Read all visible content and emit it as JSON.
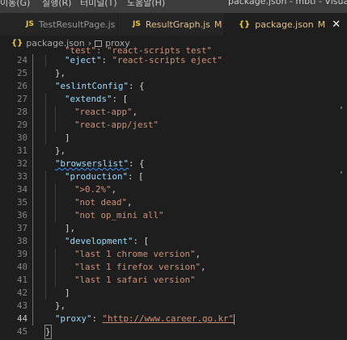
{
  "menubar": {
    "items": [
      "이동(G)",
      "실행(R)",
      "터미널(T)",
      "도움말(H)"
    ],
    "title": "package.json - mbti - Visual Studi"
  },
  "tabs": [
    {
      "label": "TestResultPage.js",
      "icon": "JS",
      "modified": ""
    },
    {
      "label": "ResultGraph.js",
      "icon": "JS",
      "modified": "M"
    },
    {
      "label": "package.json",
      "icon": "{}",
      "modified": "M",
      "close": "✕"
    }
  ],
  "breadcrumb": {
    "icon": "{}",
    "file": "package.json",
    "separator": "›",
    "property": "proxy"
  },
  "editor": {
    "line_numbers": [
      "24",
      "25",
      "26",
      "27",
      "28",
      "29",
      "30",
      "31",
      "32",
      "33",
      "34",
      "35",
      "36",
      "37",
      "38",
      "39",
      "40",
      "41",
      "42",
      "43",
      "44",
      "45"
    ],
    "partial_line": "\"eject\": \"react-scripts eject\"",
    "lines": [
      {
        "key": "\"eject\"",
        "colon": ": ",
        "value": "\"react-scripts eject\"",
        "end": ""
      },
      {
        "text": "},"
      },
      {
        "key": "\"eslintConfig\"",
        "colon": ": ",
        "text_end": "{"
      },
      {
        "key": "\"extends\"",
        "colon": ": ",
        "text_end": "["
      },
      {
        "value": "\"react-app\"",
        "end": ","
      },
      {
        "value": "\"react-app/jest\"",
        "end": ""
      },
      {
        "text": "]"
      },
      {
        "text": "},"
      },
      {
        "key": "\"browserslist\"",
        "colon": ": ",
        "text_end": "{"
      },
      {
        "key": "\"production\"",
        "colon": ": ",
        "text_end": "["
      },
      {
        "value": "\">0.2%\"",
        "end": ","
      },
      {
        "value": "\"not dead\"",
        "end": ","
      },
      {
        "value": "\"not op_mini all\"",
        "end": ""
      },
      {
        "text": "],"
      },
      {
        "key": "\"development\"",
        "colon": ": ",
        "text_end": "["
      },
      {
        "value": "\"last 1 chrome version\"",
        "end": ","
      },
      {
        "value": "\"last 1 firefox version\"",
        "end": ","
      },
      {
        "value": "\"last 1 safari version\"",
        "end": ""
      },
      {
        "text": "]"
      },
      {
        "text": "},"
      },
      {
        "key": "\"proxy\"",
        "colon": ": ",
        "value": "\"http://www.career.go.kr\"",
        "end": ""
      },
      {
        "text": "}"
      }
    ],
    "overflow_marker": "'",
    "current_line": "44"
  },
  "colors": {
    "background": "#1e1e1e",
    "key": "#9cdcfe",
    "string": "#ce9178",
    "modified": "#e2c08d",
    "json_icon": "#e8c94a"
  }
}
